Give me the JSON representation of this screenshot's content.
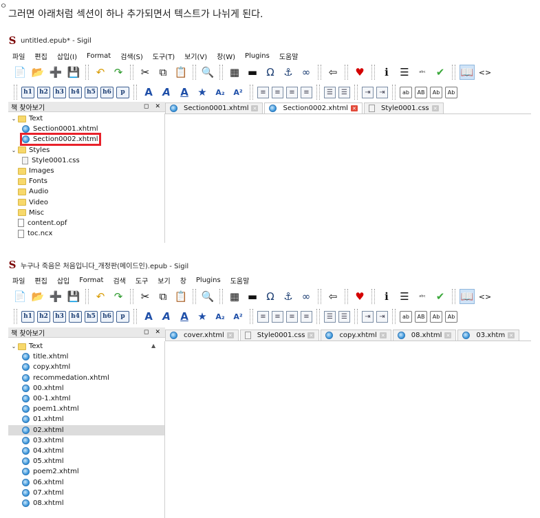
{
  "caption": {
    "bullet": "ㅇ",
    "text": "그러면 아래처럼 섹션이 하나 추가되면서 텍스트가 나뉘게 된다."
  },
  "shot1": {
    "window_title": "untitled.epub* - Sigil",
    "menu": [
      "파일",
      "편집",
      "삽입(I)",
      "Format",
      "검색(S)",
      "도구(T)",
      "보기(V)",
      "창(W)",
      "Plugins",
      "도움말"
    ],
    "panel_title": "책 찾아보기",
    "panel_controls": "◻ ✕",
    "tabs": [
      {
        "label": "Section0001.xhtml",
        "type": "html",
        "active": false
      },
      {
        "label": "Section0002.xhtml",
        "type": "html",
        "active": true
      },
      {
        "label": "Style0001.css",
        "type": "css",
        "active": false
      }
    ],
    "tree": [
      {
        "label": "Text",
        "kind": "folder",
        "expanded": true,
        "indent": 0
      },
      {
        "label": "Section0001.xhtml",
        "kind": "html",
        "indent": 1
      },
      {
        "label": "Section0002.xhtml",
        "kind": "html",
        "indent": 1,
        "highlighted": true
      },
      {
        "label": "Styles",
        "kind": "folder",
        "expanded": true,
        "indent": 0
      },
      {
        "label": "Style0001.css",
        "kind": "css",
        "indent": 1
      },
      {
        "label": "Images",
        "kind": "folder",
        "indent": 0
      },
      {
        "label": "Fonts",
        "kind": "folder",
        "indent": 0
      },
      {
        "label": "Audio",
        "kind": "folder",
        "indent": 0
      },
      {
        "label": "Video",
        "kind": "folder",
        "indent": 0
      },
      {
        "label": "Misc",
        "kind": "folder",
        "indent": 0
      },
      {
        "label": "content.opf",
        "kind": "file",
        "indent": 0
      },
      {
        "label": "toc.ncx",
        "kind": "file",
        "indent": 0
      }
    ]
  },
  "shot2": {
    "window_title": "누구나 죽음은 처음입니다_개정판(메이드인).epub - Sigil",
    "menu": [
      "파일",
      "편집",
      "삽입",
      "Format",
      "검색",
      "도구",
      "보기",
      "창",
      "Plugins",
      "도움말"
    ],
    "panel_title": "책 찾아보기",
    "panel_controls": "◻ ✕",
    "tabs": [
      {
        "label": "cover.xhtml",
        "type": "html",
        "active": false
      },
      {
        "label": "Style0001.css",
        "type": "css",
        "active": false
      },
      {
        "label": "copy.xhtml",
        "type": "html",
        "active": false
      },
      {
        "label": "08.xhtml",
        "type": "html",
        "active": false
      },
      {
        "label": "03.xhtm",
        "type": "html",
        "active": false
      }
    ],
    "tree": [
      {
        "label": "Text",
        "kind": "folder",
        "expanded": true,
        "indent": 0
      },
      {
        "label": "title.xhtml",
        "kind": "html",
        "indent": 1
      },
      {
        "label": "copy.xhtml",
        "kind": "html",
        "indent": 1
      },
      {
        "label": "recommedation.xhtml",
        "kind": "html",
        "indent": 1
      },
      {
        "label": "00.xhtml",
        "kind": "html",
        "indent": 1
      },
      {
        "label": "00-1.xhtml",
        "kind": "html",
        "indent": 1
      },
      {
        "label": "poem1.xhtml",
        "kind": "html",
        "indent": 1
      },
      {
        "label": "01.xhtml",
        "kind": "html",
        "indent": 1
      },
      {
        "label": "02.xhtml",
        "kind": "html",
        "indent": 1,
        "selected": true
      },
      {
        "label": "03.xhtml",
        "kind": "html",
        "indent": 1
      },
      {
        "label": "04.xhtml",
        "kind": "html",
        "indent": 1
      },
      {
        "label": "05.xhtml",
        "kind": "html",
        "indent": 1
      },
      {
        "label": "poem2.xhtml",
        "kind": "html",
        "indent": 1
      },
      {
        "label": "06.xhtml",
        "kind": "html",
        "indent": 1
      },
      {
        "label": "07.xhtml",
        "kind": "html",
        "indent": 1
      },
      {
        "label": "08.xhtml",
        "kind": "html",
        "indent": 1
      }
    ]
  },
  "toolbar": {
    "row1": [
      {
        "name": "new-file-icon",
        "glyph": "📄"
      },
      {
        "name": "open-folder-icon",
        "glyph": "📂"
      },
      {
        "name": "add-file-icon",
        "glyph": "➕"
      },
      {
        "name": "save-icon",
        "glyph": "💾"
      },
      {
        "sep": true
      },
      {
        "name": "undo-icon",
        "glyph": "↶"
      },
      {
        "name": "redo-icon",
        "glyph": "↷"
      },
      {
        "sep": true
      },
      {
        "name": "cut-icon",
        "glyph": "✂"
      },
      {
        "name": "copy-icon",
        "glyph": "⧉"
      },
      {
        "name": "paste-icon",
        "glyph": "📋"
      },
      {
        "sep": true
      },
      {
        "name": "find-icon",
        "glyph": "🔍"
      },
      {
        "sep": true
      },
      {
        "name": "insert-image-icon",
        "glyph": "▦"
      },
      {
        "name": "insert-special-icon",
        "glyph": "▬"
      },
      {
        "name": "omega-icon",
        "glyph": "Ω"
      },
      {
        "name": "anchor-icon",
        "glyph": "⚓"
      },
      {
        "name": "link-icon",
        "glyph": "∞"
      },
      {
        "sep": true
      },
      {
        "name": "back-icon",
        "glyph": "⇦"
      },
      {
        "sep": true
      },
      {
        "name": "heart-icon",
        "glyph": "♥"
      },
      {
        "sep": true
      },
      {
        "name": "info-icon",
        "glyph": "ℹ"
      },
      {
        "name": "toc-icon",
        "glyph": "☰"
      },
      {
        "name": "spellcheck-icon",
        "glyph": "ᵃᵇᶜ"
      },
      {
        "name": "validate-icon",
        "glyph": "✔"
      },
      {
        "sep": true
      },
      {
        "name": "book-view-icon",
        "glyph": "📖",
        "selected": true
      },
      {
        "name": "code-view-icon",
        "glyph": "<>"
      }
    ],
    "headings": [
      "h1",
      "h2",
      "h3",
      "h4",
      "h5",
      "h6",
      "p"
    ],
    "format_icons": [
      {
        "name": "bold-icon",
        "glyph": "A"
      },
      {
        "name": "italic-icon",
        "glyph": "A"
      },
      {
        "name": "underline-icon",
        "glyph": "A"
      },
      {
        "name": "strikethrough-icon",
        "glyph": "★"
      },
      {
        "name": "subscript-icon",
        "glyph": "A₂"
      },
      {
        "name": "superscript-icon",
        "glyph": "A²"
      }
    ],
    "align_icons": [
      "align-left-icon",
      "align-center-icon",
      "align-right-icon",
      "align-justify-icon"
    ],
    "list_icons": [
      "bullet-list-icon",
      "numbered-list-icon"
    ],
    "indent_icons": [
      "decrease-indent-icon",
      "increase-indent-icon"
    ],
    "case_buttons": [
      "ab",
      "AB",
      "Ab",
      "Ab"
    ]
  },
  "colors": {
    "highlight": "#e8212a",
    "sigil_brand": "#7a0000",
    "tab_close_active": "#e24a3a"
  }
}
